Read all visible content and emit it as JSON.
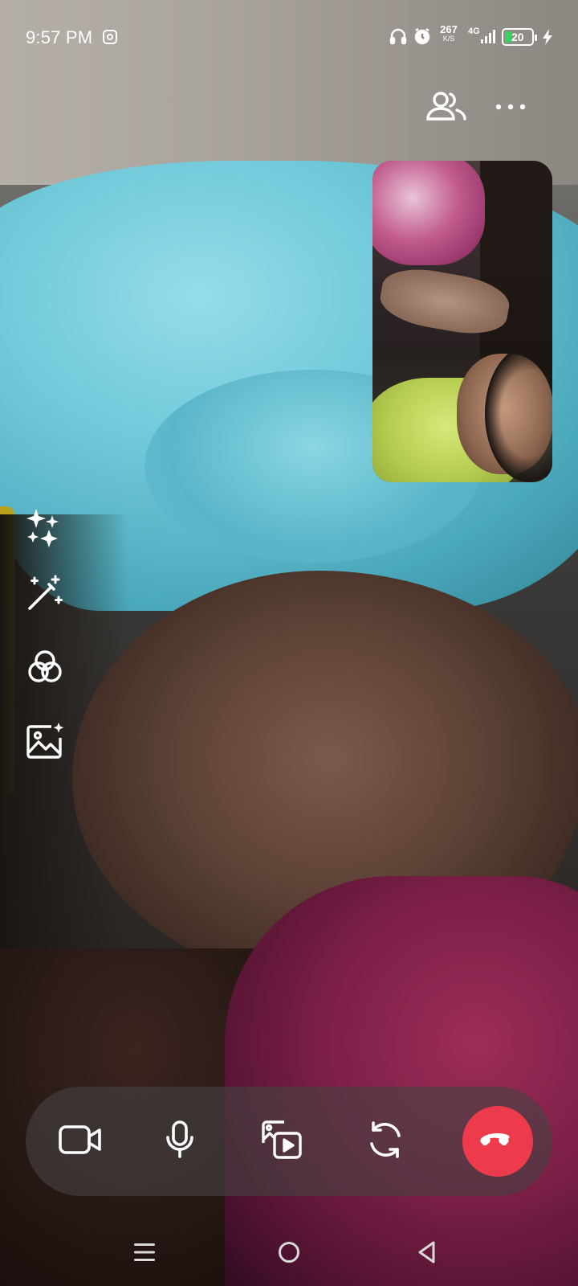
{
  "status_bar": {
    "time": "9:57 PM",
    "net_speed_value": "267",
    "net_speed_unit": "K/S",
    "network_type": "4G",
    "battery_level": "20",
    "icons": [
      "instagram-icon",
      "headphones-icon",
      "alarm-icon",
      "signal-icon",
      "battery-icon",
      "charging-icon"
    ]
  },
  "top_actions": {
    "participants_icon": "people-icon",
    "more_icon": "more-horizontal-icon"
  },
  "side_tools": [
    "sparkles-icon",
    "magic-wand-icon",
    "filters-icon",
    "background-image-icon"
  ],
  "controls": {
    "video_icon": "video-camera-icon",
    "mic_icon": "microphone-icon",
    "media_icon": "share-media-icon",
    "flip_icon": "flip-camera-icon",
    "end_icon": "end-call-icon",
    "end_color": "#ee3b4c"
  },
  "nav_bar": [
    "menu-icon",
    "home-icon",
    "back-icon"
  ]
}
